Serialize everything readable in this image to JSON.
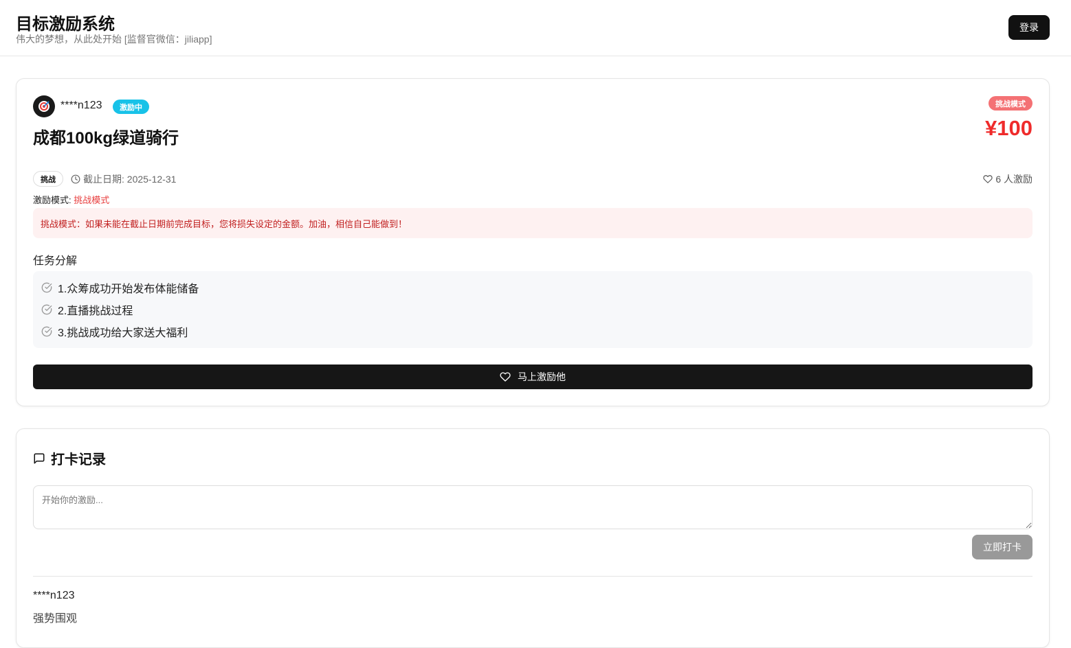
{
  "header": {
    "title": "目标激励系统",
    "subtitle": "伟大的梦想，从此处开始 [监督官微信：jiliapp]",
    "login_label": "登录"
  },
  "goal": {
    "username": "****n123",
    "status": "激励中",
    "title": "成都100kg绿道骑行",
    "mode_badge": "挑战模式",
    "amount": "¥100",
    "type_tag": "挑战",
    "deadline": "截止日期: 2025-12-31",
    "supporters": "6 人激励",
    "mode_label": "激励模式:",
    "mode_value": "挑战模式",
    "warning": "挑战模式：如果未能在截止日期前完成目标，您将损失设定的金额。加油，相信自己能做到！",
    "tasks_title": "任务分解",
    "tasks": [
      "1.众筹成功开始发布体能储备",
      "2.直播挑战过程",
      "3.挑战成功给大家送大福利"
    ],
    "encourage_label": "马上激励他"
  },
  "checkin": {
    "title": "打卡记录",
    "placeholder": "开始你的激励...",
    "submit_label": "立即打卡",
    "records": [
      {
        "user": "****n123",
        "content": "强势围观"
      }
    ]
  },
  "colors": {
    "accent": "#111111",
    "status_badge": "#18c2e8",
    "mode_badge": "#f47174",
    "amount": "#ef2b2b",
    "warning_bg": "#fef1f1"
  },
  "icons": [
    "target-icon",
    "clock-icon",
    "heart-icon",
    "check-circle-icon",
    "message-icon"
  ]
}
